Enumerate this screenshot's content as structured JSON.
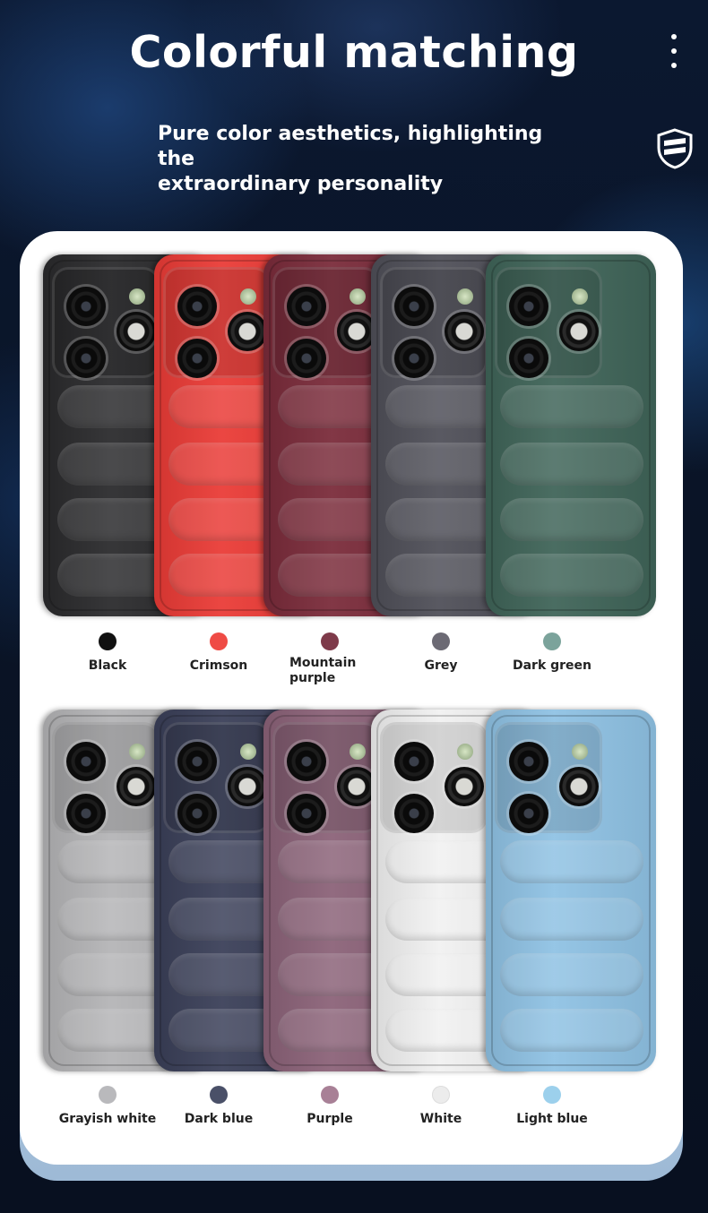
{
  "header": {
    "title": "Colorful matching",
    "subtitle_line1": "Pure color aesthetics, highlighting the",
    "subtitle_line2": "extraordinary personality"
  },
  "icons": {
    "menu": "more-vertical-icon",
    "badge": "shield-badge-icon"
  },
  "row1": [
    {
      "name": "Black",
      "color": "#2a2a2c",
      "swatch": "#111111"
    },
    {
      "name": "Crimson",
      "color": "#ea3b36",
      "swatch": "#ef4b45"
    },
    {
      "name": "Mountain purple",
      "color": "#7a2b3a",
      "swatch": "#7e3a4a"
    },
    {
      "name": "Grey",
      "color": "#4f4f58",
      "swatch": "#6c6a74"
    },
    {
      "name": "Dark green",
      "color": "#3f6458",
      "swatch": "#7ba39b"
    }
  ],
  "row2": [
    {
      "name": "Grayish white",
      "color": "#b4b4b6",
      "swatch": "#b9b9bc"
    },
    {
      "name": "Dark blue",
      "color": "#3a3f58",
      "swatch": "#4a5068"
    },
    {
      "name": "Purple",
      "color": "#8b6278",
      "swatch": "#a88096"
    },
    {
      "name": "White",
      "color": "#f1f1f1",
      "swatch": "#ececec"
    },
    {
      "name": "Light blue",
      "color": "#8fc2e4",
      "swatch": "#9cd0ec"
    }
  ]
}
